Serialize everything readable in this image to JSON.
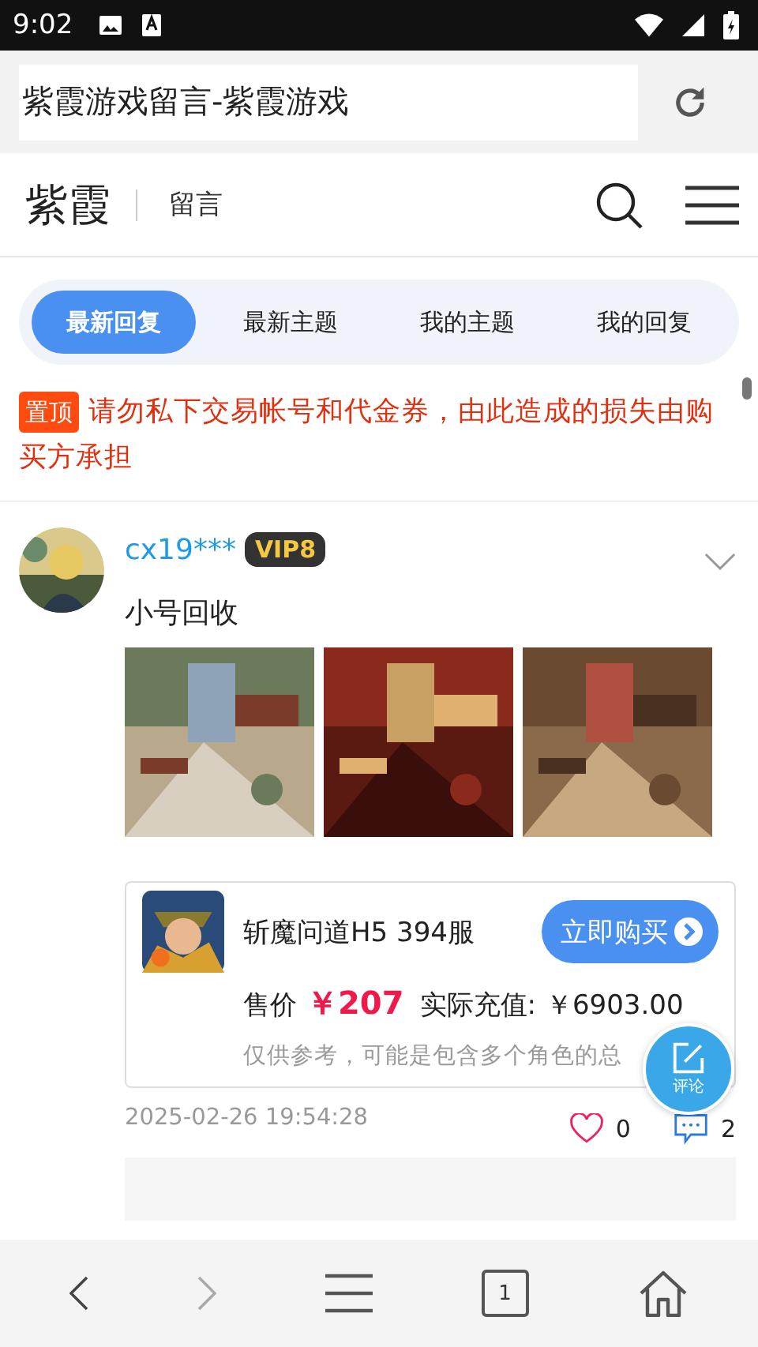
{
  "status_bar": {
    "time": "9:02"
  },
  "address_bar": {
    "title": "紫霞游戏留言-紫霞游戏"
  },
  "site_header": {
    "logo": "紫霞",
    "section": "留言"
  },
  "tabs": [
    {
      "label": "最新回复",
      "selected": true
    },
    {
      "label": "最新主题",
      "selected": false
    },
    {
      "label": "我的主题",
      "selected": false
    },
    {
      "label": "我的回复",
      "selected": false
    }
  ],
  "notice": {
    "badge": "置顶",
    "text": "请勿私下交易帐号和代金券，由此造成的损失由购买方承担"
  },
  "posts": [
    {
      "username": "cx19***",
      "vip": "VIP8",
      "content": "小号回收",
      "product": {
        "name": "斩魔问道H5 394服",
        "buy_button": "立即购买",
        "price_label": "售价",
        "price": "￥207",
        "recharge_label": "实际充值:",
        "recharge": "￥6903.00",
        "note": "仅供参考，可能是包含多个角色的总"
      },
      "time": "2025-02-26 19:54:28",
      "likes": "0",
      "comments": "2"
    }
  ],
  "fab": {
    "label": "评论"
  },
  "bottom_nav": [
    {
      "kind": "back",
      "disabled": false
    },
    {
      "kind": "forward",
      "disabled": true
    },
    {
      "kind": "menu",
      "disabled": false
    },
    {
      "kind": "tabs",
      "count": "1",
      "disabled": false
    },
    {
      "kind": "home",
      "disabled": false
    }
  ]
}
